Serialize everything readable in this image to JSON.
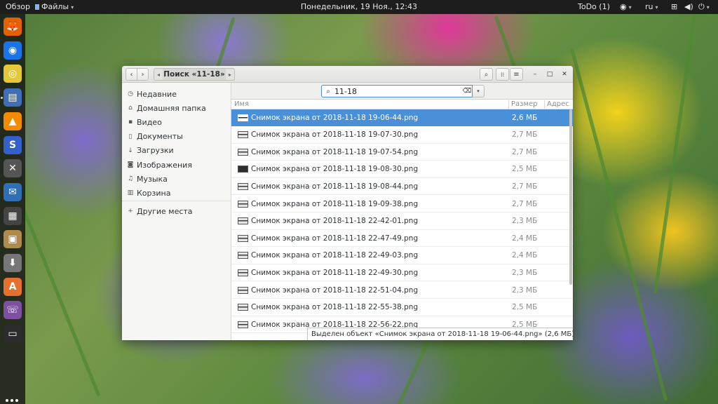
{
  "topbar": {
    "overview": "Обзор",
    "app_menu": "Файлы",
    "clock": "Понедельник, 19 Ноя., 12:43",
    "todo": "ToDo (1)",
    "lang": "ru",
    "caret": "▾"
  },
  "dock": {
    "items": [
      {
        "name": "firefox",
        "glyph": "🦊",
        "color": "#e66000"
      },
      {
        "name": "chrome",
        "glyph": "◉",
        "color": "#1a73e8"
      },
      {
        "name": "rhythmbox",
        "glyph": "◎",
        "color": "#e3c83a"
      },
      {
        "name": "files",
        "glyph": "▤",
        "color": "#3f6fb8"
      },
      {
        "name": "vlc",
        "glyph": "▲",
        "color": "#f28b00"
      },
      {
        "name": "simplenote",
        "glyph": "S",
        "color": "#3361cc"
      },
      {
        "name": "tools",
        "glyph": "✕",
        "color": "#555"
      },
      {
        "name": "thunderbird",
        "glyph": "✉",
        "color": "#2f6fb5"
      },
      {
        "name": "calculator",
        "glyph": "▦",
        "color": "#444"
      },
      {
        "name": "archive-manager",
        "glyph": "▣",
        "color": "#b08a4a"
      },
      {
        "name": "downloader",
        "glyph": "⬇",
        "color": "#777"
      },
      {
        "name": "software",
        "glyph": "A",
        "color": "#e6702e"
      },
      {
        "name": "viber",
        "glyph": "☏",
        "color": "#7d51a0"
      },
      {
        "name": "terminal",
        "glyph": "▭",
        "color": "#2c2c2c"
      }
    ]
  },
  "headerbar": {
    "back": "‹",
    "forward": "›",
    "path_left": "◂",
    "path_right": "▸",
    "location": "Поиск «11-18»",
    "search_glyph": "⌕",
    "view_glyph": "⁞⁞",
    "menu_glyph": "≡",
    "minimize": "–",
    "maximize": "□",
    "close": "✕"
  },
  "sidebar": {
    "items": [
      {
        "label": "Недавние",
        "icon": "◷",
        "icon_name": "recent-icon"
      },
      {
        "label": "Домашняя папка",
        "icon": "⌂",
        "icon_name": "home-icon"
      },
      {
        "label": "Видео",
        "icon": "▪",
        "icon_name": "video-icon"
      },
      {
        "label": "Документы",
        "icon": "▯",
        "icon_name": "document-icon"
      },
      {
        "label": "Загрузки",
        "icon": "↓",
        "icon_name": "download-icon"
      },
      {
        "label": "Изображения",
        "icon": "◙",
        "icon_name": "image-icon"
      },
      {
        "label": "Музыка",
        "icon": "♫",
        "icon_name": "music-icon"
      },
      {
        "label": "Корзина",
        "icon": "▥",
        "icon_name": "trash-icon"
      }
    ],
    "other_places": {
      "label": "Другие места",
      "icon": "+"
    }
  },
  "search": {
    "value": "11-18",
    "icon": "⌕",
    "clear": "⌫",
    "dropdown": "▾"
  },
  "columns": {
    "name": "Имя",
    "size": "Размер",
    "address": "Адрес"
  },
  "files": [
    {
      "name": "Снимок экрана от 2018-11-18 19-06-44.png",
      "size": "2,6 МБ",
      "selected": true
    },
    {
      "name": "Снимок экрана от 2018-11-18 19-07-30.png",
      "size": "2,7 МБ"
    },
    {
      "name": "Снимок экрана от 2018-11-18 19-07-54.png",
      "size": "2,7 МБ"
    },
    {
      "name": "Снимок экрана от 2018-11-18 19-08-30.png",
      "size": "2,5 МБ",
      "dark": true
    },
    {
      "name": "Снимок экрана от 2018-11-18 19-08-44.png",
      "size": "2,7 МБ"
    },
    {
      "name": "Снимок экрана от 2018-11-18 19-09-38.png",
      "size": "2,7 МБ"
    },
    {
      "name": "Снимок экрана от 2018-11-18 22-42-01.png",
      "size": "2,3 МБ"
    },
    {
      "name": "Снимок экрана от 2018-11-18 22-47-49.png",
      "size": "2,4 МБ"
    },
    {
      "name": "Снимок экрана от 2018-11-18 22-49-03.png",
      "size": "2,4 МБ"
    },
    {
      "name": "Снимок экрана от 2018-11-18 22-49-30.png",
      "size": "2,3 МБ"
    },
    {
      "name": "Снимок экрана от 2018-11-18 22-51-04.png",
      "size": "2,3 МБ"
    },
    {
      "name": "Снимок экрана от 2018-11-18 22-55-38.png",
      "size": "2,5 МБ"
    },
    {
      "name": "Снимок экрана от 2018-11-18 22-56-22.png",
      "size": "2,5 МБ"
    }
  ],
  "status": "Выделен объект «Снимок экрана от 2018-11-18 19-06-44.png» (2,6 МБ)",
  "colors": {
    "accent": "#4a90d9",
    "topbar": "#1d1d1d"
  }
}
